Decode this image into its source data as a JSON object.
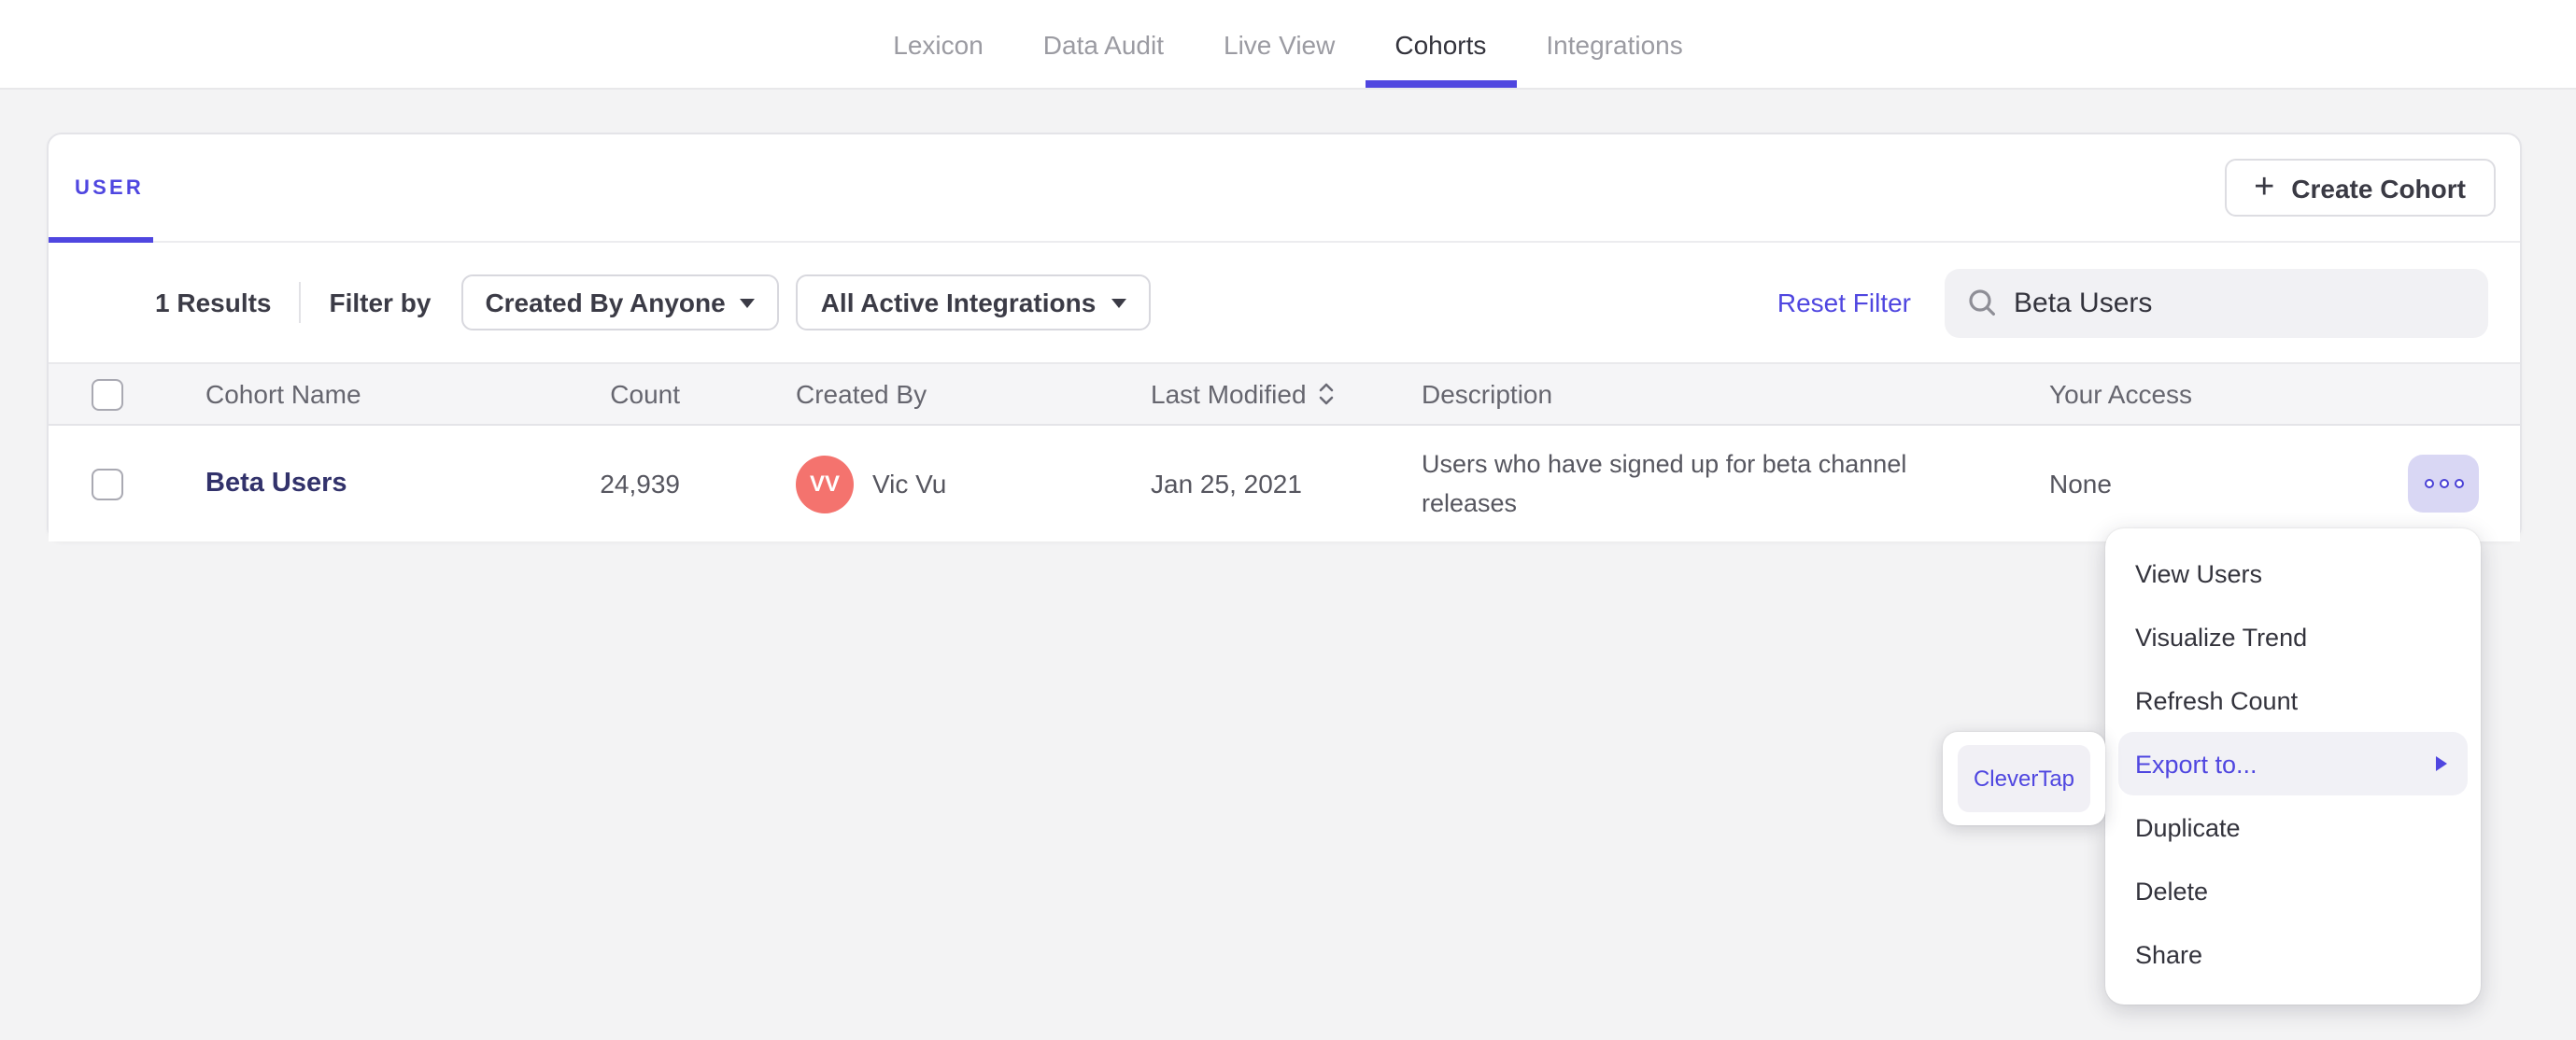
{
  "colors": {
    "accent": "#4f46e0",
    "avatar_bg": "#f4736e",
    "page_bg": "#f3f3f4"
  },
  "nav": {
    "items": [
      {
        "label": "Lexicon",
        "active": false
      },
      {
        "label": "Data Audit",
        "active": false
      },
      {
        "label": "Live View",
        "active": false
      },
      {
        "label": "Cohorts",
        "active": true
      },
      {
        "label": "Integrations",
        "active": false
      }
    ]
  },
  "panel": {
    "tab_label": "USER",
    "create_button": {
      "plus": "+",
      "label": "Create Cohort"
    },
    "filters": {
      "results_count": "1 Results",
      "filter_by_label": "Filter by",
      "created_by_dropdown": "Created By Anyone",
      "integrations_dropdown": "All Active Integrations",
      "reset_label": "Reset Filter",
      "search_value": "Beta Users"
    },
    "table": {
      "headers": {
        "name": "Cohort Name",
        "count": "Count",
        "created_by": "Created By",
        "last_modified": "Last Modified",
        "description": "Description",
        "access": "Your Access"
      },
      "row": {
        "name": "Beta Users",
        "count": "24,939",
        "avatar_initials": "VV",
        "created_by": "Vic Vu",
        "last_modified": "Jan 25, 2021",
        "description": "Users who have signed up for beta channel releases",
        "access": "None"
      }
    }
  },
  "context_menu": {
    "items": [
      {
        "label": "View Users",
        "highlighted": false
      },
      {
        "label": "Visualize Trend",
        "highlighted": false
      },
      {
        "label": "Refresh Count",
        "highlighted": false
      },
      {
        "label": "Export to...",
        "highlighted": true,
        "has_submenu": true
      },
      {
        "label": "Duplicate",
        "highlighted": false
      },
      {
        "label": "Delete",
        "highlighted": false
      },
      {
        "label": "Share",
        "highlighted": false
      }
    ]
  },
  "export_submenu": {
    "items": [
      {
        "label": "CleverTap"
      }
    ]
  }
}
